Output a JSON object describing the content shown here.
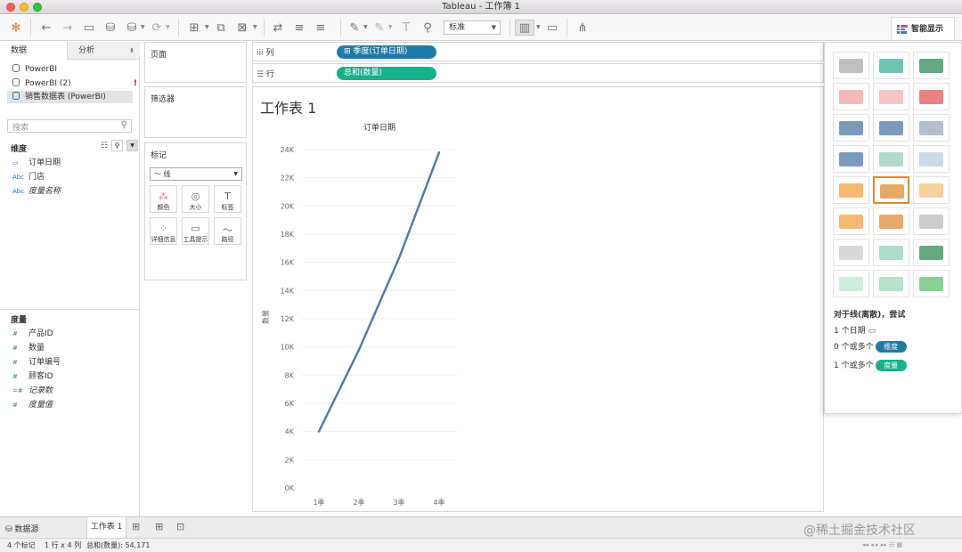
{
  "window": {
    "title": "Tableau - 工作簿 1"
  },
  "toolbar": {
    "standard_label": "标准",
    "smart_show_label": "智能显示"
  },
  "datapane": {
    "tab_data": "数据",
    "tab_analysis": "分析",
    "sources": [
      {
        "name": "PowerBI"
      },
      {
        "name": "PowerBI (2)",
        "warning": "!"
      },
      {
        "name": "销售数据表 (PowerBI)"
      }
    ],
    "search_placeholder": "搜索",
    "dimensions_header": "维度",
    "dimensions": [
      {
        "type": "date",
        "name": "订单日期"
      },
      {
        "type": "Abc",
        "name": "门店"
      },
      {
        "type": "Abc",
        "name": "度量名称"
      }
    ],
    "measures_header": "度量",
    "measures": [
      {
        "type": "#",
        "name": "产品ID"
      },
      {
        "type": "#",
        "name": "数量"
      },
      {
        "type": "#",
        "name": "订单编号"
      },
      {
        "type": "#",
        "name": "顾客ID"
      },
      {
        "type": "=#",
        "name": "记录数"
      },
      {
        "type": "#",
        "name": "度量值"
      }
    ]
  },
  "cards": {
    "pages": "页面",
    "filters": "筛选器",
    "marks": "标记",
    "mark_type": "线",
    "mark_buttons": [
      "颜色",
      "大小",
      "标签",
      "详细信息",
      "工具提示",
      "路径"
    ]
  },
  "shelves": {
    "columns_label": "列",
    "columns_pill": "季度(订单日期)",
    "rows_label": "行",
    "rows_pill": "总和(数量)"
  },
  "sheet": {
    "title": "工作表 1"
  },
  "colors": {
    "blue_pill": "#1f7ba6",
    "green_pill": "#17b28a",
    "line": "#4e79a7"
  },
  "chart_data": {
    "type": "line",
    "title": "订单日期",
    "ylabel": "数量",
    "categories": [
      "1季",
      "2季",
      "3季",
      "4季"
    ],
    "values": [
      4000,
      9800,
      16300,
      23800
    ],
    "yticks": [
      "0K",
      "2K",
      "4K",
      "6K",
      "8K",
      "10K",
      "12K",
      "14K",
      "16K",
      "18K",
      "20K",
      "22K",
      "24K"
    ],
    "ylim": [
      0,
      24000
    ]
  },
  "smart": {
    "hint_title": "对于线(离散)，尝试",
    "hint_1": "1 个日期",
    "hint_2_prefix": "0 个或多个",
    "hint_2_pill": "维度",
    "hint_3_prefix": "1 个或多个",
    "hint_3_pill": "度量"
  },
  "tabs": {
    "datasource": "数据源",
    "sheet1": "工作表 1"
  },
  "status": {
    "marks": "4 个标记",
    "rows_cols": "1 行 x 4 列",
    "sum": "总和(数量): 54,171"
  },
  "watermark": "@稀土掘金技术社区"
}
